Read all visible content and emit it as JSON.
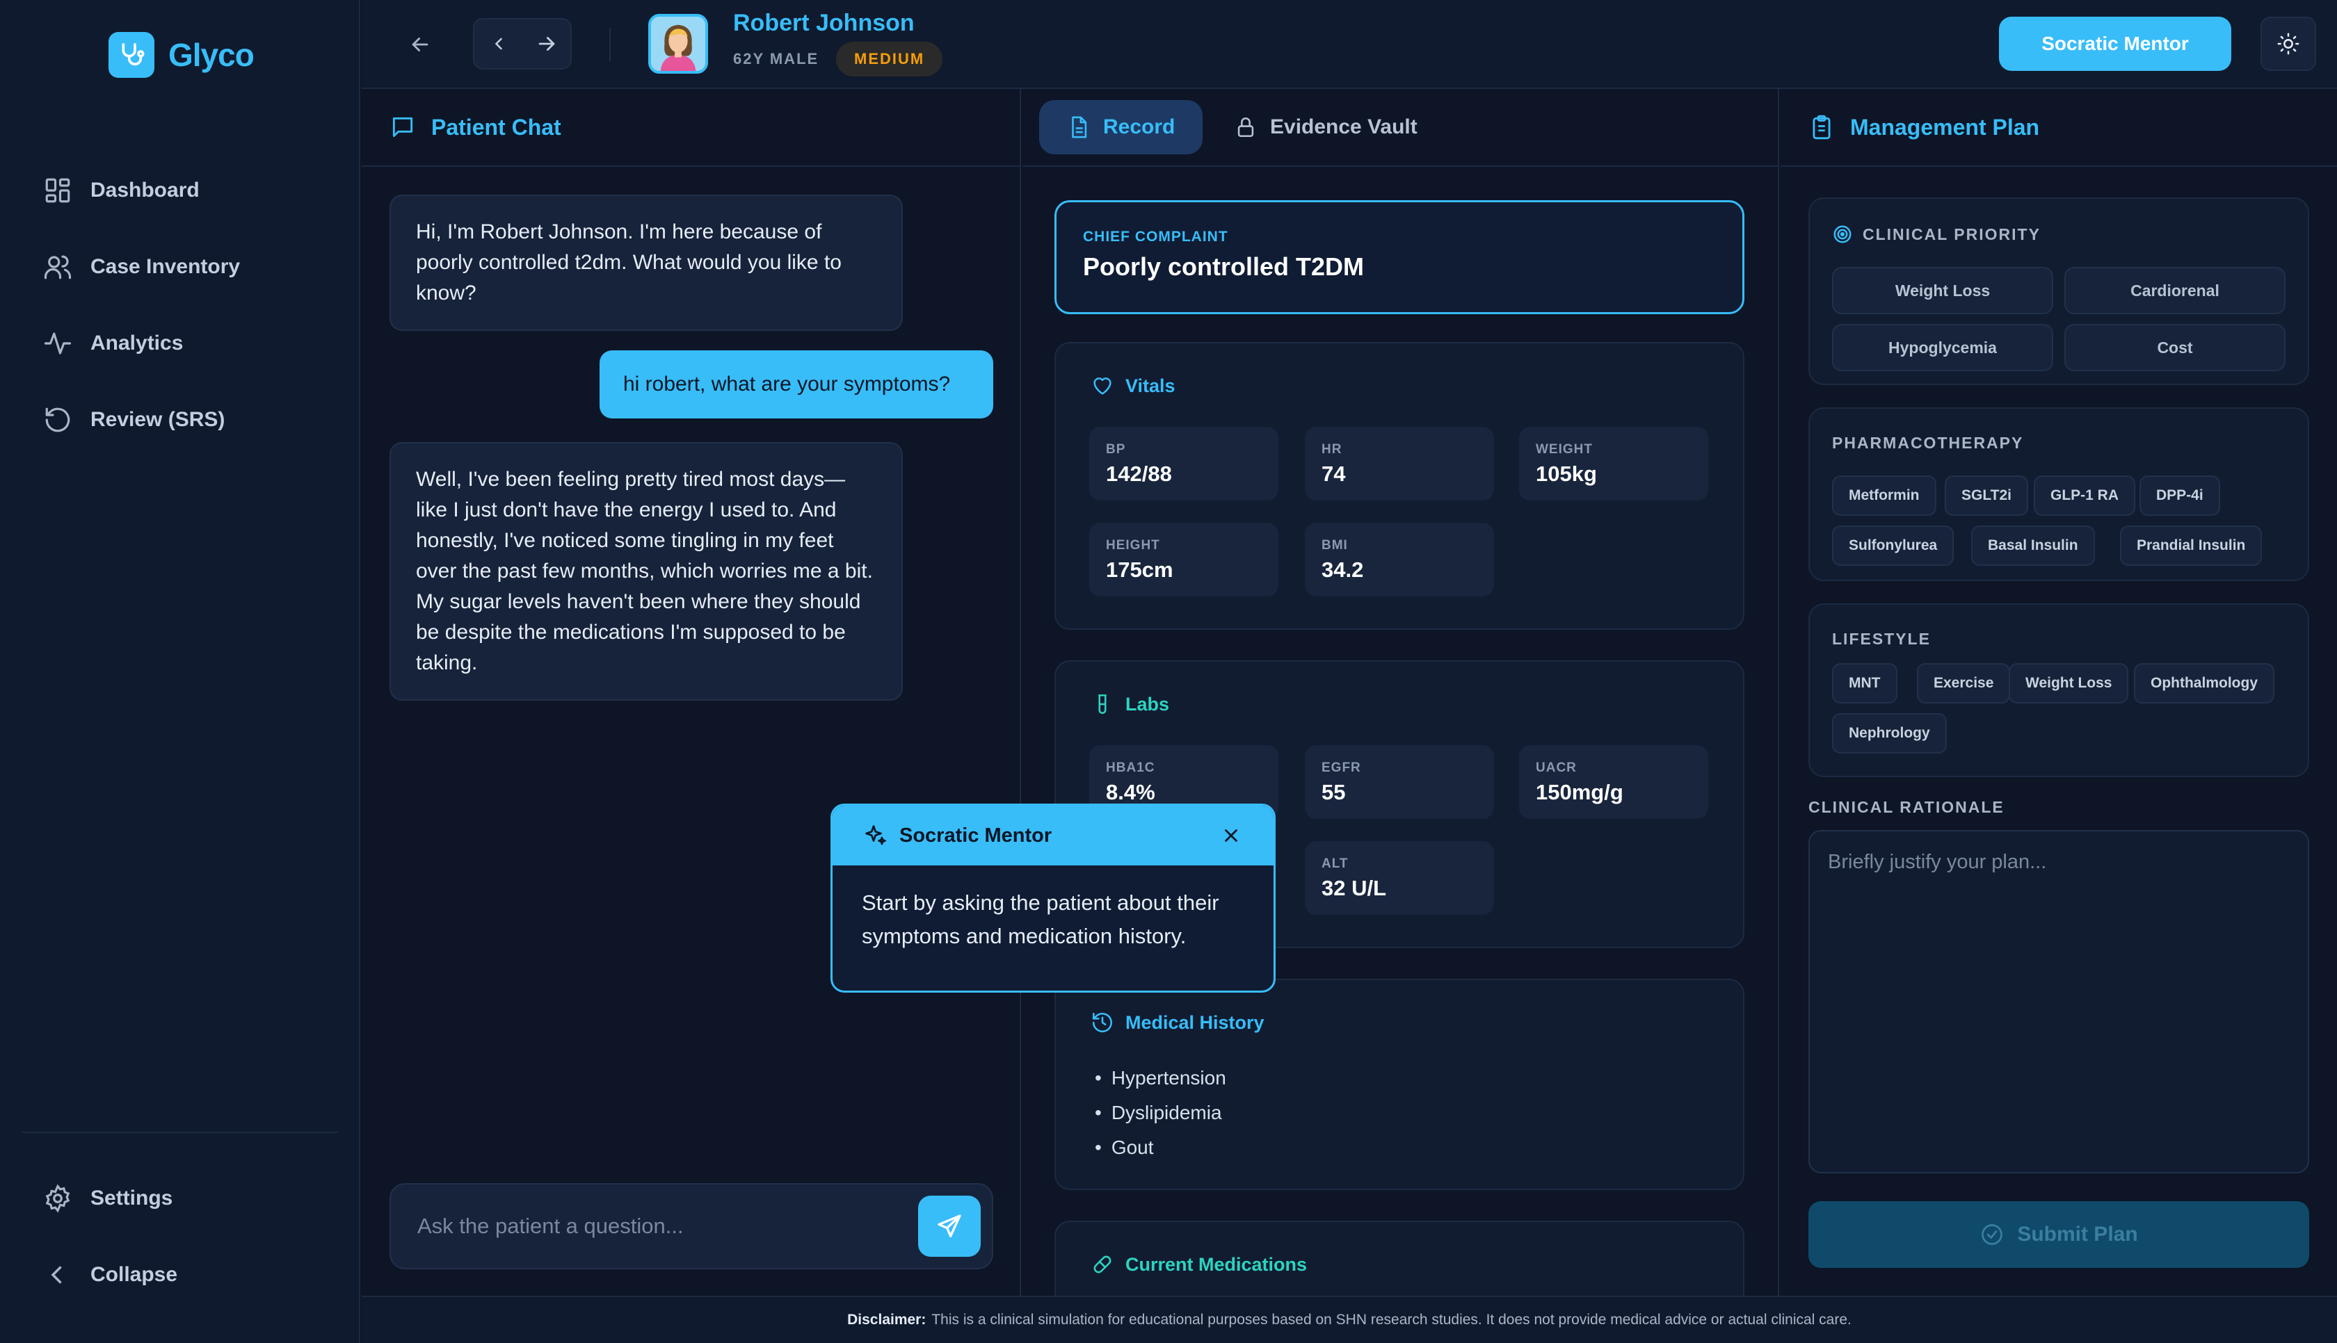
{
  "app": {
    "name": "Glyco"
  },
  "sidebar": {
    "items": [
      {
        "label": "Dashboard",
        "icon": "grid-icon"
      },
      {
        "label": "Case Inventory",
        "icon": "users-icon"
      },
      {
        "label": "Analytics",
        "icon": "activity-icon"
      },
      {
        "label": "Review (SRS)",
        "icon": "refresh-icon"
      }
    ],
    "bottom": [
      {
        "label": "Settings",
        "icon": "gear-icon"
      },
      {
        "label": "Collapse",
        "icon": "chevron-left-icon"
      }
    ]
  },
  "header": {
    "patient_name": "Robert Johnson",
    "patient_meta": "62Y MALE",
    "difficulty": "MEDIUM",
    "mentor_button": "Socratic Mentor"
  },
  "chat": {
    "title": "Patient Chat",
    "messages": [
      {
        "role": "patient",
        "text": "Hi, I'm Robert Johnson. I'm here because of poorly controlled t2dm. What would you like to know?"
      },
      {
        "role": "user",
        "text": "hi robert, what are your symptoms?"
      },
      {
        "role": "patient",
        "text": "Well, I've been feeling pretty tired most days—like I just don't have the energy I used to. And honestly, I've noticed some tingling in my feet over the past few months, which worries me a bit. My sugar levels haven't been where they should be despite the medications I'm supposed to be taking."
      }
    ],
    "input_placeholder": "Ask the patient a question..."
  },
  "record": {
    "tabs": [
      {
        "label": "Record",
        "active": true
      },
      {
        "label": "Evidence Vault",
        "active": false
      }
    ],
    "chief_complaint_label": "CHIEF COMPLAINT",
    "chief_complaint": "Poorly controlled T2DM",
    "vitals": {
      "title": "Vitals",
      "items": [
        {
          "label": "BP",
          "value": "142/88"
        },
        {
          "label": "HR",
          "value": "74"
        },
        {
          "label": "WEIGHT",
          "value": "105kg"
        },
        {
          "label": "HEIGHT",
          "value": "175cm"
        },
        {
          "label": "BMI",
          "value": "34.2"
        }
      ]
    },
    "labs": {
      "title": "Labs",
      "items": [
        {
          "label": "HBA1C",
          "value": "8.4%"
        },
        {
          "label": "EGFR",
          "value": "55"
        },
        {
          "label": "UACR",
          "value": "150mg/g"
        },
        {
          "label": "ALT",
          "value": "32 U/L"
        }
      ]
    },
    "history": {
      "title": "Medical History",
      "items": [
        "Hypertension",
        "Dyslipidemia",
        "Gout"
      ]
    },
    "medications": {
      "title": "Current Medications"
    }
  },
  "mentor_popup": {
    "title": "Socratic Mentor",
    "text": "Start by asking the patient about their symptoms and medication history."
  },
  "plan": {
    "title": "Management Plan",
    "priority": {
      "title": "CLINICAL PRIORITY",
      "options": [
        "Weight Loss",
        "Cardiorenal",
        "Hypoglycemia",
        "Cost"
      ]
    },
    "pharmacotherapy": {
      "title": "PHARMACOTHERAPY",
      "options": [
        "Metformin",
        "SGLT2i",
        "GLP-1 RA",
        "DPP-4i",
        "Sulfonylurea",
        "Basal Insulin",
        "Prandial Insulin"
      ]
    },
    "lifestyle": {
      "title": "LIFESTYLE",
      "options": [
        "MNT",
        "Exercise",
        "Weight Loss",
        "Ophthalmology",
        "Nephrology"
      ]
    },
    "rationale_label": "CLINICAL RATIONALE",
    "rationale_placeholder": "Briefly justify your plan...",
    "submit_label": "Submit Plan"
  },
  "footer": {
    "label": "Disclaimer:",
    "text": "This is a clinical simulation for educational purposes based on SHN research studies. It does not provide medical advice or actual clinical care."
  },
  "colors": {
    "accent": "#38bdf8",
    "background": "#0d1526",
    "panel": "#111c31",
    "warning": "#f59e0b",
    "vitals_accent": "#38bdf8",
    "labs_accent": "#2dd4bf",
    "meds_accent": "#2dd4bf"
  }
}
